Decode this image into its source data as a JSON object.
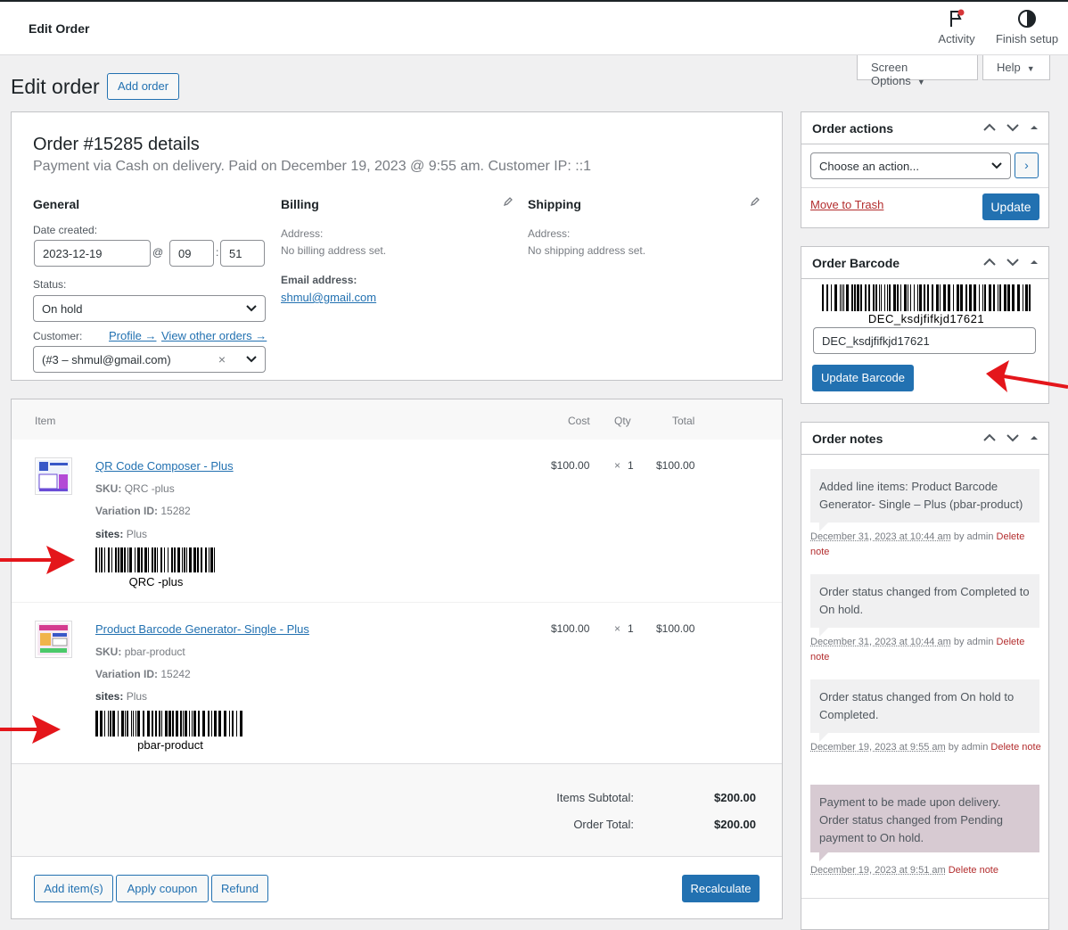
{
  "topbar": {
    "title": "Edit Order",
    "activity": "Activity",
    "finish_setup": "Finish setup"
  },
  "screen_options": {
    "label": "Screen Options",
    "help": "Help"
  },
  "page": {
    "title": "Edit order",
    "add_order": "Add order"
  },
  "order": {
    "heading": "Order #15285 details",
    "subheading": "Payment via Cash on delivery. Paid on December 19, 2023 @ 9:55 am. Customer IP: ::1",
    "general": {
      "title": "General",
      "date_created_label": "Date created:",
      "date": "2023-12-19",
      "at": "@",
      "hour": "09",
      "colon": ":",
      "minute": "51",
      "status_label": "Status:",
      "status": "On hold",
      "customer_label": "Customer:",
      "profile_link": "Profile →",
      "view_orders_link": "View other orders →",
      "customer": "(#3 – shmul@gmail.com)",
      "clear": "×"
    },
    "billing": {
      "title": "Billing",
      "address_label": "Address:",
      "address_value": "No billing address set.",
      "email_label": "Email address:",
      "email": "shmul@gmail.com"
    },
    "shipping": {
      "title": "Shipping",
      "address_label": "Address:",
      "address_value": "No shipping address set."
    }
  },
  "items": {
    "headers": {
      "item": "Item",
      "cost": "Cost",
      "qty": "Qty",
      "total": "Total"
    },
    "rows": [
      {
        "name": "QR Code Composer - Plus",
        "sku_label": "SKU:",
        "sku": "QRC -plus",
        "variation_label": "Variation ID:",
        "variation": "15282",
        "sites_label": "sites:",
        "sites": "Plus",
        "cost": "$100.00",
        "times": "×",
        "qty": "1",
        "total": "$100.00",
        "barcode_text": "QRC -plus"
      },
      {
        "name": "Product Barcode Generator- Single - Plus",
        "sku_label": "SKU:",
        "sku": "pbar-product",
        "variation_label": "Variation ID:",
        "variation": "15242",
        "sites_label": "sites:",
        "sites": "Plus",
        "cost": "$100.00",
        "times": "×",
        "qty": "1",
        "total": "$100.00",
        "barcode_text": "pbar-product"
      }
    ],
    "subtotal_label": "Items Subtotal:",
    "subtotal": "$200.00",
    "order_total_label": "Order Total:",
    "order_total": "$200.00",
    "add_items": "Add item(s)",
    "apply_coupon": "Apply coupon",
    "refund": "Refund",
    "recalculate": "Recalculate"
  },
  "order_actions": {
    "title": "Order actions",
    "select": "Choose an action...",
    "trash": "Move to Trash",
    "update": "Update"
  },
  "order_barcode": {
    "title": "Order Barcode",
    "barcode_text": "DEC_ksdjfifkjd17621",
    "input_value": "DEC_ksdjfifkjd17621",
    "button": "Update Barcode"
  },
  "order_notes": {
    "title": "Order notes",
    "notes": [
      {
        "text": "Added line items: Product Barcode Generator- Single – Plus (pbar-product)",
        "date": "December 31, 2023 at 10:44 am",
        "by": "by admin",
        "delete": "Delete note"
      },
      {
        "text": "Order status changed from Completed to On hold.",
        "date": "December 31, 2023 at 10:44 am",
        "by": "by admin",
        "delete": "Delete note"
      },
      {
        "text": "Order status changed from On hold to Completed.",
        "date": "December 19, 2023 at 9:55 am",
        "by": "by admin",
        "delete": "Delete note"
      },
      {
        "text": "Payment to be made upon delivery. Order status changed from Pending payment to On hold.",
        "date": "December 19, 2023 at 9:51 am",
        "by": "",
        "delete": "Delete note"
      }
    ]
  },
  "colors": {
    "primary": "#2271b1",
    "arrow": "#e4161b",
    "system_note": "#d7cad2",
    "trash": "#b32d2e"
  }
}
